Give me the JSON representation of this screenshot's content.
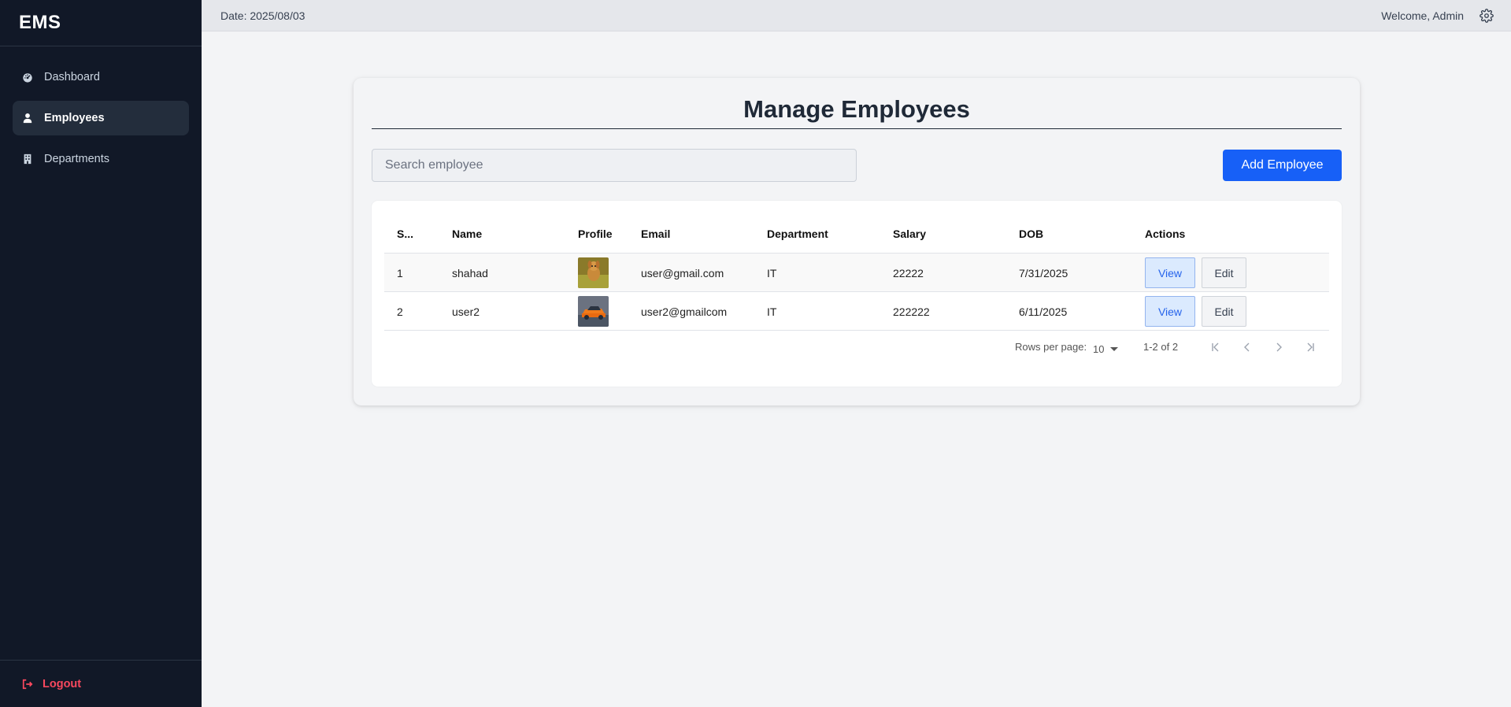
{
  "app": {
    "brand": "EMS"
  },
  "sidebar": {
    "items": [
      {
        "label": "Dashboard",
        "icon": "tachometer-icon",
        "active": false
      },
      {
        "label": "Employees",
        "icon": "user-icon",
        "active": true
      },
      {
        "label": "Departments",
        "icon": "building-icon",
        "active": false
      }
    ],
    "logout": "Logout"
  },
  "topbar": {
    "date": "Date: 2025/08/03",
    "welcome": "Welcome, Admin"
  },
  "main": {
    "title": "Manage Employees",
    "search_placeholder": "Search employee",
    "add_button": "Add Employee"
  },
  "table": {
    "columns": [
      "S...",
      "Name",
      "Profile",
      "Email",
      "Department",
      "Salary",
      "DOB",
      "Actions"
    ],
    "rows": [
      {
        "sno": "1",
        "name": "shahad",
        "profile": "dog-photo",
        "email": "user@gmail.com",
        "department": "IT",
        "salary": "22222",
        "dob": "7/31/2025",
        "view": "View",
        "edit": "Edit"
      },
      {
        "sno": "2",
        "name": "user2",
        "profile": "car-photo",
        "email": "user2@gmailcom",
        "department": "IT",
        "salary": "222222",
        "dob": "6/11/2025",
        "view": "View",
        "edit": "Edit"
      }
    ]
  },
  "pagination": {
    "rows_per_page_label": "Rows per page:",
    "rows_per_page": "10",
    "range": "1-2 of 2"
  },
  "colors": {
    "sidebar_bg": "#111827",
    "accent": "#1760f7",
    "logout": "#f8485e"
  }
}
